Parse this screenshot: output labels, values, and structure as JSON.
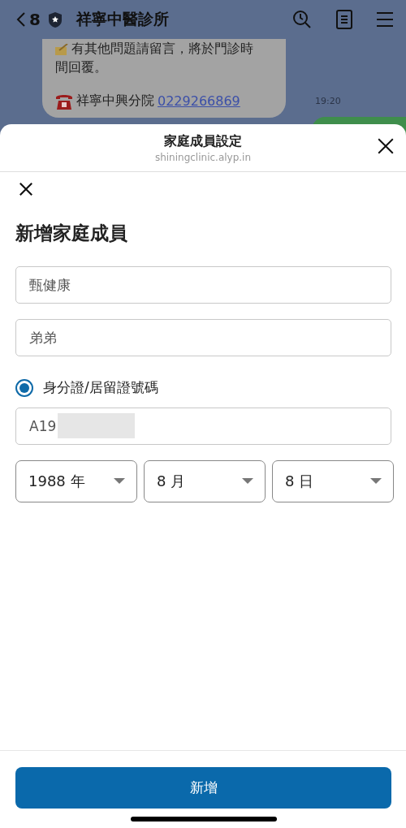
{
  "chat_header": {
    "back_count": "8",
    "title": "祥寧中醫診所"
  },
  "chat": {
    "message_lines": [
      "有其他問題請留言，將於門診時",
      "間回覆。"
    ],
    "phone_label": "祥寧中興分院",
    "phone_link": "0229266869",
    "time": "19:20"
  },
  "sheet": {
    "title": "家庭成員設定",
    "domain": "shiningclinic.alyp.in"
  },
  "form": {
    "heading": "新增家庭成員",
    "name_field": {
      "value": "甄健康"
    },
    "relation_field": {
      "value": "弟弟"
    },
    "id_option": {
      "label": "身分證/居留證號碼",
      "selected": true
    },
    "id_field": {
      "value": "A19",
      "redacted": true
    },
    "birth_selects": [
      {
        "value": "1988 年"
      },
      {
        "value": "8 月"
      },
      {
        "value": "8 日"
      }
    ]
  },
  "submit_button": "新增"
}
